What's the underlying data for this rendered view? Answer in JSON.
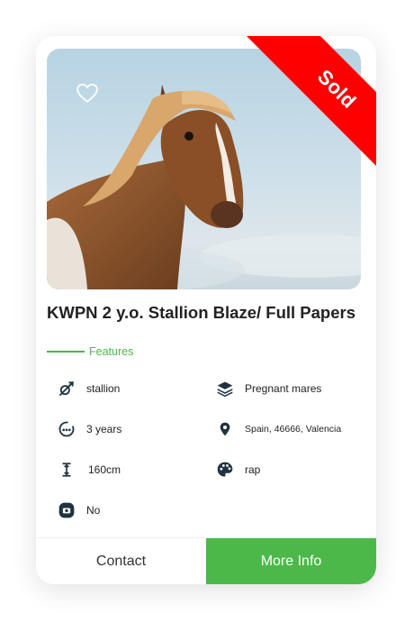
{
  "listing": {
    "status": "Sold",
    "title": "KWPN 2 y.o. Stallion Blaze/ Full Papers",
    "features_label": "Features",
    "features": {
      "gender": "stallion",
      "pregnant_mares": "Pregnant mares",
      "age": "3 years",
      "location": "Spain, 46666, Valencia",
      "height": "160cm",
      "color": "rap",
      "extra": "No"
    }
  },
  "actions": {
    "contact_label": "Contact",
    "more_info_label": "More Info"
  },
  "colors": {
    "accent": "#4cb84a",
    "sold_ribbon": "#ff0000",
    "icon": "#1f3340"
  },
  "icons": {
    "favorite": "heart-outline-icon",
    "gender": "no-gender-icon",
    "pregnant_mares": "layers-icon",
    "age": "age-counter-icon",
    "location": "map-pin-icon",
    "height": "height-arrows-icon",
    "color": "palette-icon",
    "extra": "camera-badge-icon"
  }
}
